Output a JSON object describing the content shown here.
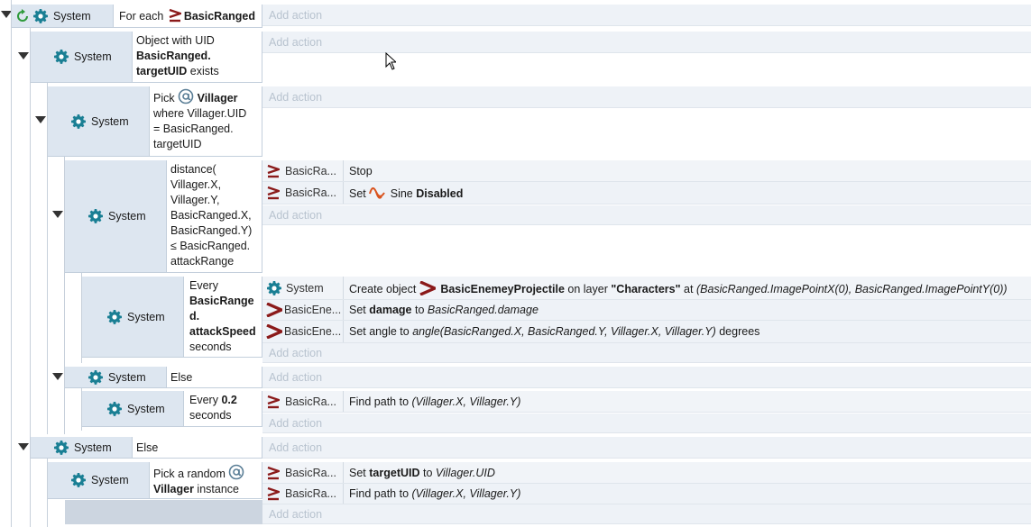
{
  "events": {
    "e1": {
      "object": "System",
      "cond_prefix": "For each",
      "cond_obj": "BasicRanged",
      "add_action": "Add action"
    },
    "e2": {
      "object": "System",
      "line1": "Object with UID",
      "line2": "BasicRanged.",
      "line3": "targetUID",
      "line3b": "exists",
      "add_action": "Add action"
    },
    "e3": {
      "object": "System",
      "pick": "Pick",
      "pick_obj": "Villager",
      "l2": "where Villager.UID",
      "l3": "= BasicRanged.",
      "l4": "targetUID",
      "add_action": "Add action"
    },
    "e4": {
      "object": "System",
      "cond_lines": [
        "distance(",
        "Villager.X,",
        "Villager.Y,",
        "BasicRanged.X,",
        "BasicRanged.Y)",
        "≤ BasicRanged.",
        "attackRange"
      ],
      "actions": [
        {
          "obj": "BasicRa...",
          "text": "Stop"
        },
        {
          "obj": "BasicRa...",
          "pre": "Set",
          "beh": "Sine",
          "post": "Disabled"
        }
      ],
      "add_action": "Add action"
    },
    "e5": {
      "object": "System",
      "c1": "Every",
      "c2": "BasicRange",
      "c3": "d.",
      "c4": "attackSpeed",
      "c5": "seconds",
      "actions": [
        {
          "obj": "System",
          "pre": "Create object",
          "target": "BasicEnemeyProjectile",
          "mid": "on layer",
          "layer": "\"Characters\"",
          "at": "at",
          "expr": "(BasicRanged.ImagePointX(0), BasicRanged.ImagePointY(0))"
        },
        {
          "obj": "BasicEne...",
          "pre": "Set",
          "var": "damage",
          "to": "to",
          "expr": "BasicRanged.damage"
        },
        {
          "obj": "BasicEne...",
          "pre": "Set angle to",
          "expr": "angle(BasicRanged.X, BasicRanged.Y, Villager.X, Villager.Y)",
          "post": "degrees"
        }
      ],
      "add_action": "Add action"
    },
    "e6": {
      "object": "System",
      "cond": "Else",
      "add_action": "Add action"
    },
    "e7": {
      "object": "System",
      "c1": "Every",
      "c2": "0.2",
      "c3": "seconds",
      "actions": [
        {
          "obj": "BasicRa...",
          "pre": "Find path to",
          "expr": "(Villager.X, Villager.Y)"
        }
      ],
      "add_action": "Add action"
    },
    "e8": {
      "object": "System",
      "cond": "Else",
      "add_action": "Add action"
    },
    "e9": {
      "object": "System",
      "c1": "Pick a random",
      "c2": "Villager",
      "c2b": "instance",
      "actions": [
        {
          "obj": "BasicRa...",
          "pre": "Set",
          "var": "targetUID",
          "to": "to",
          "expr": "Villager.UID"
        },
        {
          "obj": "BasicRa...",
          "pre": "Find path to",
          "expr": "(Villager.X, Villager.Y)"
        }
      ],
      "add_action": "Add action"
    }
  },
  "colors": {
    "event_bg": "#dde6f0",
    "action_bg": "#eef2f7",
    "add_action_text": "#b8c3cf",
    "sprite_red": "#8b1a1a",
    "behavior_orange": "#d9531e",
    "gear_teal": "#1a7f94",
    "loop_green": "#2e9a3a"
  }
}
